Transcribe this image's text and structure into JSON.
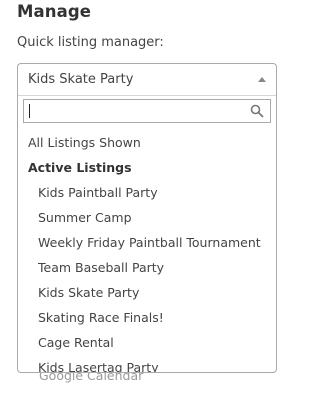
{
  "section": {
    "title": "Manage",
    "label": "Quick listing manager:"
  },
  "background": {
    "partial_item": "Google Calendar"
  },
  "dropdown": {
    "selected": "Kids Skate Party",
    "search": {
      "value": "",
      "placeholder": ""
    },
    "all_option": "All Listings Shown",
    "group_label": "Active Listings",
    "options": [
      "Kids Paintball Party",
      "Summer Camp",
      "Weekly Friday Paintball Tournament",
      "Team Baseball Party",
      "Kids Skate Party",
      "Skating Race Finals!",
      "Cage Rental",
      "Kids Lasertag Party"
    ],
    "icons": {
      "caret": "caret-up-icon",
      "search": "search-icon"
    }
  }
}
